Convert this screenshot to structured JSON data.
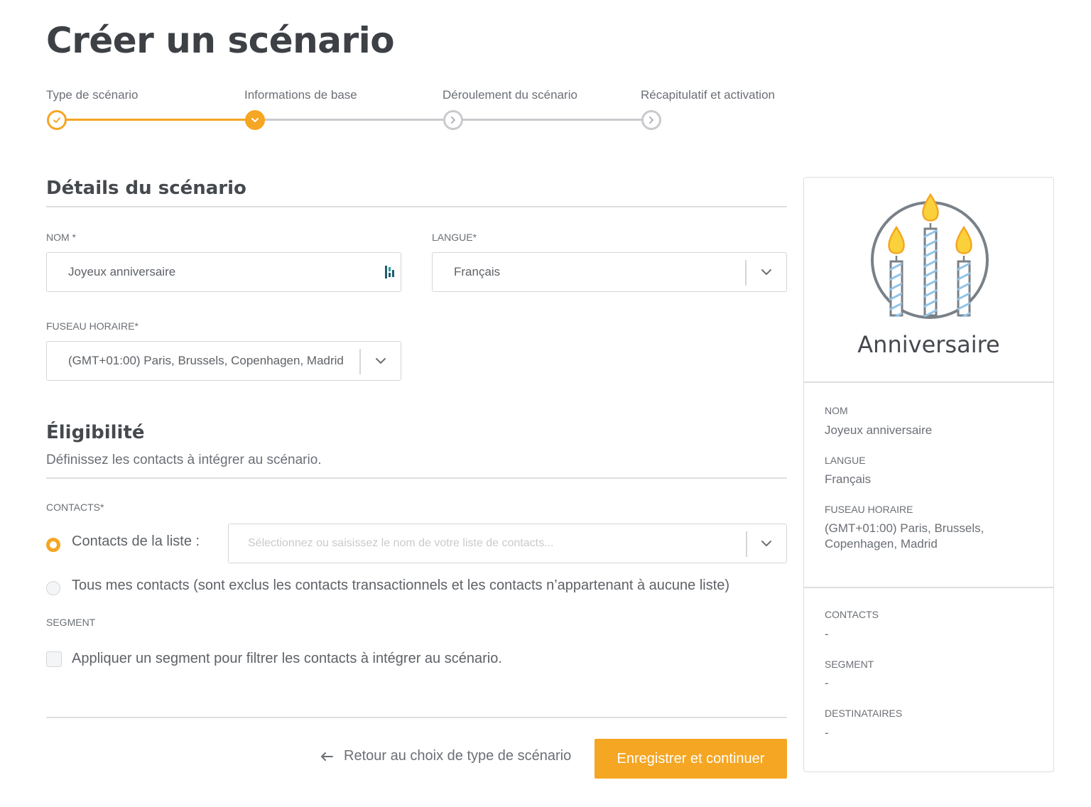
{
  "page": {
    "title": "Créer un scénario"
  },
  "colors": {
    "accent": "#f5a623",
    "border": "#d4d6d9",
    "text": "#555a60"
  },
  "stepper": {
    "steps": [
      {
        "label": "Type de scénario",
        "state": "done"
      },
      {
        "label": "Informations de base",
        "state": "active"
      },
      {
        "label": "Déroulement du scénario",
        "state": "pending"
      },
      {
        "label": "Récapitulatif et activation",
        "state": "pending"
      }
    ]
  },
  "details": {
    "heading": "Détails du scénario",
    "name": {
      "label": "NOM *",
      "value": "Joyeux anniversaire"
    },
    "language": {
      "label": "LANGUE*",
      "value": "Français"
    },
    "timezone": {
      "label": "FUSEAU HORAIRE*",
      "value": "(GMT+01:00) Paris, Brussels, Copenhagen, Madrid"
    }
  },
  "eligibility": {
    "heading": "Éligibilité",
    "description": "Définissez les contacts à intégrer au scénario.",
    "contacts_label": "CONTACTS*",
    "option_list": "Contacts de la liste :",
    "list_placeholder": "Sélectionnez ou saisissez le nom de votre liste de contacts...",
    "option_all": "Tous mes contacts (sont exclus les contacts transactionnels et les contacts n’appartenant à aucune liste)",
    "segment_label": "SEGMENT",
    "segment_option": "Appliquer un segment pour filtrer les contacts à intégrer au scénario."
  },
  "actions": {
    "back": "Retour au choix de type de scénario",
    "submit": "Enregistrer et continuer"
  },
  "summary": {
    "title": "Anniversaire",
    "icon": "birthday-candles-icon",
    "name_label": "NOM",
    "name_value": "Joyeux anniversaire",
    "language_label": "LANGUE",
    "language_value": "Français",
    "timezone_label": "FUSEAU HORAIRE",
    "timezone_value": "(GMT+01:00) Paris, Brussels, Copenhagen, Madrid",
    "contacts_label": "CONTACTS",
    "contacts_value": "-",
    "segment_label": "SEGMENT",
    "segment_value": "-",
    "recipients_label": "DESTINATAIRES",
    "recipients_value": "-"
  }
}
